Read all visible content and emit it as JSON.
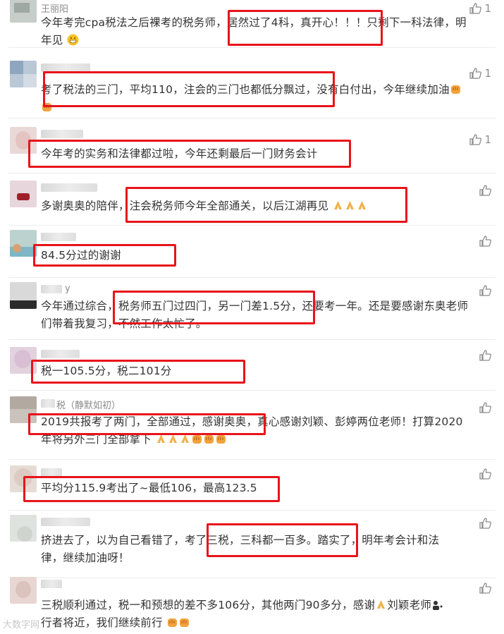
{
  "comments": [
    {
      "username": "王丽阳",
      "likes": "1",
      "line1": "今年考完cpa税法之后裸考的税务师，居然过了4科，真开心！！！只剩下一科法律，明",
      "line2": "年见"
    },
    {
      "username": "",
      "likes": "1",
      "line1": "考了税法的三门，平均110，注会的三门也都低分飘过，没有白付出，今年继续加油",
      "line2": ""
    },
    {
      "username": "",
      "likes": "1",
      "line1": "今年考的实务和法律都过啦，今年还剩最后一门财务会计",
      "line2": ""
    },
    {
      "username": "",
      "likes": "",
      "line1": "多谢奥奥的陪伴，注会税务师今年全部通关，以后江湖再见",
      "line2": ""
    },
    {
      "username": "",
      "likes": "",
      "line1": "84.5分过的谢谢",
      "line2": ""
    },
    {
      "username": "y",
      "likes": "",
      "line1": "今年通过综合，税务师五门过四门，另一门差1.5分，还要考一年。还是要感谢东奥老师",
      "line2": "们带着我复习，不然工作太忙了。"
    },
    {
      "username": "",
      "likes": "",
      "line1": "税一105.5分，税二101分",
      "line2": ""
    },
    {
      "username": "税（静默如初）",
      "likes": "",
      "line1": "2019共报考了两门，全部通过，感谢奥奥，真心感谢刘颖、彭婷两位老师！打算2020",
      "line2": "年将另外三门全部拿下"
    },
    {
      "username": "",
      "likes": "",
      "line1": "平均分115.9考出了~最低106，最高123.5",
      "line2": ""
    },
    {
      "username": "",
      "likes": "",
      "line1": "挤进去了，以为自己看错了，考了三税，三科都一百多。踏实了，明年考会计和法",
      "line2": "律，继续加油呀！"
    },
    {
      "username": "",
      "likes": "",
      "line1": "三税顺利通过，税一和预想的差不多106分，其他两门90多分，感谢",
      "line1b": "刘颖老师",
      "line2": "行者将近，我们继续前行"
    }
  ],
  "watermark": "大数字网",
  "icons": {
    "like": "thumbs-up-icon"
  },
  "colors": {
    "highlight": "#e8131a",
    "text": "#333333",
    "meta": "#8a8a8a"
  }
}
